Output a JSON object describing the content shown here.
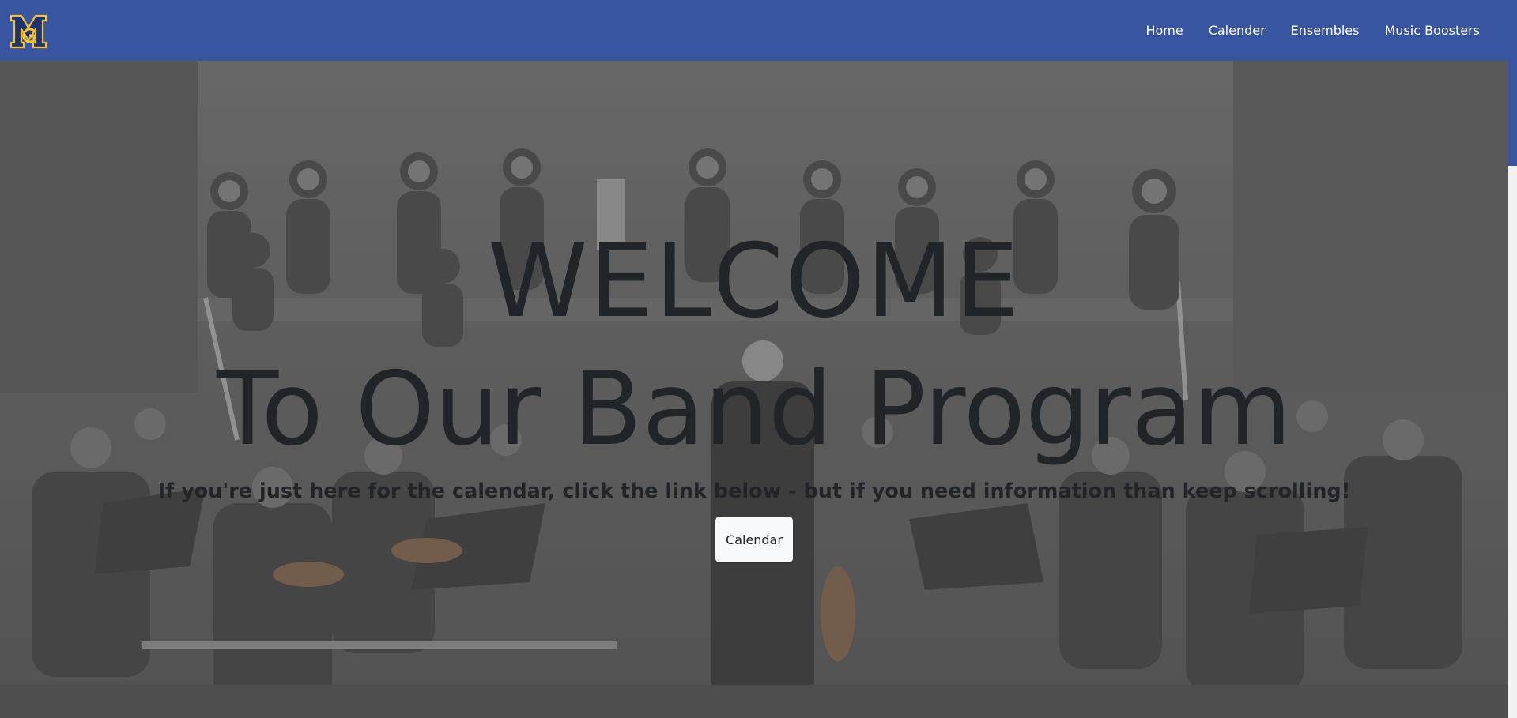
{
  "navbar": {
    "logo_icon": "school-m-logo",
    "links": [
      "Home",
      "Calender",
      "Ensembles",
      "Music Boosters"
    ],
    "background": "#3954a0"
  },
  "hero": {
    "title": "WELCOME",
    "subtitle": "To Our Band Program",
    "tagline": "If you're just here for the calendar, click the link below - but if you need information than keep scrolling!",
    "button_label": "Calendar",
    "background_image": "orchestra-choir-concert-photo"
  },
  "colors": {
    "brand_blue": "#3954a0",
    "logo_gold": "#f2c230",
    "text_dark": "#212529"
  }
}
